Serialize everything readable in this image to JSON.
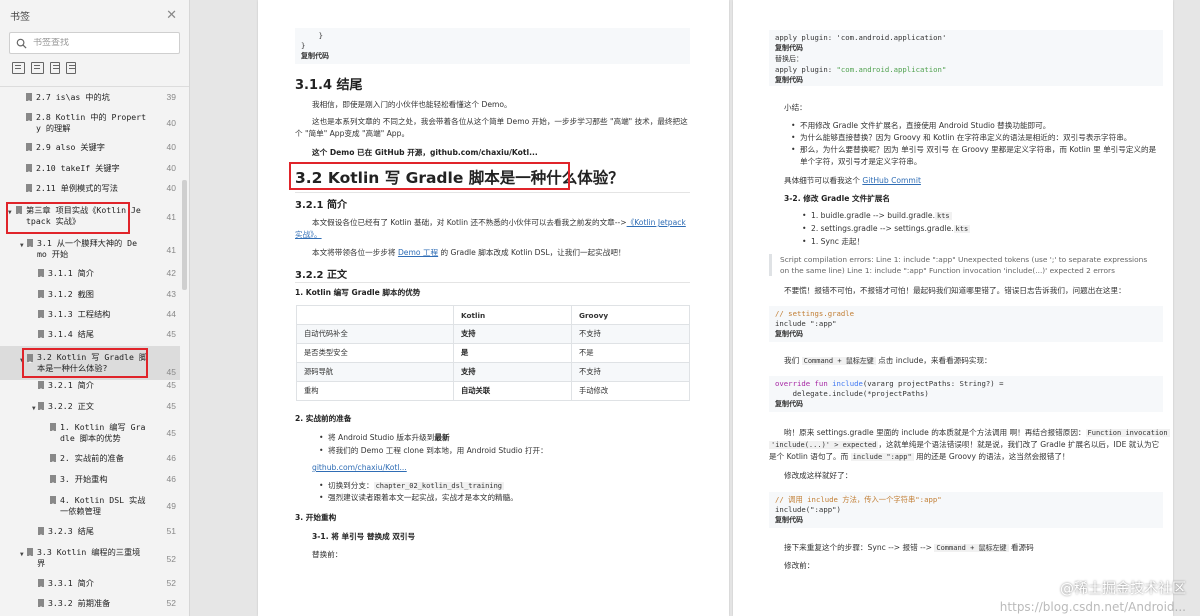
{
  "sidebar": {
    "title": "书签",
    "close_glyph": "✕",
    "search_placeholder": "书签查找",
    "items": [
      {
        "label": "2.7 is\\as 中的坑",
        "page": "39"
      },
      {
        "label": "2.8 Kotlin 中的 Propert\ny 的理解",
        "page": "40"
      },
      {
        "label": "2.9 also 关键字",
        "page": "40"
      },
      {
        "label": "2.10 takeIf 关键字",
        "page": "40"
      },
      {
        "label": "2.11 单例模式的写法",
        "page": "40"
      },
      {
        "label": "第三章 项目实战《Kotlin Je\ntpack 实战》",
        "page": "41"
      },
      {
        "label": "3.1 从一个膜拜大神的 De\nmo 开始",
        "page": "41"
      },
      {
        "label": "3.1.1 简介",
        "page": "42"
      },
      {
        "label": "3.1.2 截图",
        "page": "43"
      },
      {
        "label": "3.1.3 工程结构",
        "page": "44"
      },
      {
        "label": "3.1.4 结尾",
        "page": "45"
      },
      {
        "label": "3.2 Kotlin 写 Gradle 脚\n本是一种什么体验?",
        "page": "45"
      },
      {
        "label": "3.2.1 简介",
        "page": "45"
      },
      {
        "label": "3.2.2 正文",
        "page": "45"
      },
      {
        "label": "1. Kotlin 编写 Gra\ndle 脚本的优势",
        "page": "45"
      },
      {
        "label": "2. 实战前的准备",
        "page": "46"
      },
      {
        "label": "3. 开始重构",
        "page": "46"
      },
      {
        "label": "4. Kotlin DSL 实战\n一依赖管理",
        "page": "49"
      },
      {
        "label": "3.2.3 结尾",
        "page": "51"
      },
      {
        "label": "3.3 Kotlin 编程的三重境\n界",
        "page": "52"
      },
      {
        "label": "3.3.1 简介",
        "page": "52"
      },
      {
        "label": "3.3.2 前期准备",
        "page": "52"
      }
    ]
  },
  "page1": {
    "code_top": [
      "    }",
      "}"
    ],
    "copy": "复制代码",
    "h_3_1_4": "3.1.4 结尾",
    "p1": "我相信，即使是刚入门的小伙伴也能轻松看懂这个 Demo。",
    "p2a": "这也是本系列文章的 不同之处，我会带着各位从这个简单 Demo 开始，一步步学习那些 \"高端\" 技术，最终把这",
    "p2b": "个 \"简单\" App变成 \"高端\" App。",
    "p3": "这个 Demo 已在 GitHub 开源，github.com/chaxiu/Kotl...",
    "h_3_2": "3.2 Kotlin 写 Gradle 脚本是一种什么体验？",
    "h_3_2_1": "3.2.1 简介",
    "p4a": "本文假设各位已经有了 Kotlin 基础，对 Kotlin 还不熟悉的小伙伴可以去看我之前发的文章-->",
    "p4link1": "《Kotlin Jetpack",
    "p4link2": "实战》。",
    "p5a": "本文将带领各位一步步将 ",
    "p5link": "Demo 工程",
    "p5b": " 的 Gradle 脚本改成 Kotlin DSL，让我们一起实战吧！",
    "h_3_2_2": "3.2.2 正文",
    "h_adv": "1. Kotlin 编写 Gradle 脚本的优势",
    "table": {
      "headers": [
        "",
        "Kotlin",
        "Groovy"
      ],
      "rows": [
        [
          "自动代码补全",
          "支持",
          "不支持"
        ],
        [
          "是否类型安全",
          "是",
          "不是"
        ],
        [
          "源码导航",
          "支持",
          "不支持"
        ],
        [
          "重构",
          "自动关联",
          "手动修改"
        ]
      ]
    },
    "h_prep": "2. 实战前的准备",
    "b1a": "将 Android Studio 版本升级到",
    "b1b": "最新",
    "b2": "将我们的 Demo 工程 clone 到本地，用 Android Studio 打开：",
    "link_repo": "github.com/chaxiu/Kotl...",
    "b3a": "切换到分支：",
    "b3code": "chapter_02_kotlin_dsl_training",
    "b4": "强烈建议读者跟着本文一起实战，实战才是本文的精髓。",
    "h_refactor": "3. 开始重构",
    "h_3_1": "3-1. 将 单引号 替换成 双引号",
    "before": "替换前："
  },
  "page2": {
    "code1": [
      "apply plugin: 'com.android.application'"
    ],
    "copy": "复制代码",
    "after": "替换后：",
    "code2a": "apply plugin: ",
    "code2b": "\"com.android.application\"",
    "summary": "小结：",
    "s1": "不用修改 Gradle 文件扩展名，直接使用 Android Studio 替换功能即可。",
    "s2": "为什么能够直接替换？因为 Groovy 和 Kotlin 在字符串定义的语法是相近的：双引号表示字符串。",
    "s3a": "那么，为什么要替换呢？因为 单引号 双引号 在 Groovy 里都是定义字符串，而 Kotlin 里 单引号定义的是",
    "s3b": "单个字符，双引号才是定义字符串。",
    "detail_a": "具体细节可以看我这个 ",
    "detail_link": "GitHub Commit",
    "h_ext": "3-2. 修改 Gradle 文件扩展名",
    "n1a": "1. buidle.gradle --> build.gradle.",
    "n1b": "kts",
    "n2a": "2. settings.gradle --> settings.gradle.",
    "n2b": "kts",
    "n3": "1. Sync 走起！",
    "quote_a": "Script compilation errors: Line 1: include \":app\" Unexpected tokens (use ';' to separate expressions",
    "quote_b": "on the same line) Line 1: include \":app\" Function invocation 'include(...)' expected 2 errors",
    "panic": "不要慌！报错不可怕，不报错才可怕！最起码我们知道哪里错了。错误日志告诉我们，问题出在这里：",
    "code3_comment": "// settings.gradle",
    "code3_line": "include \":app\"",
    "note_a": "我们 ",
    "note_code": "Command + 鼠标左键",
    "note_b": " 点击 include，来看看源码实现：",
    "code4_kw": "override fun ",
    "code4_fn": "include",
    "code4_rest": "(vararg projectPaths: String?) =",
    "code4_line2": "    delegate.include(*projectPaths)",
    "exp_a": "哟！原来 settings.gradle 里面的 include 的本质就是个方法调用 啊！再结合报错原因：",
    "exp_code1": "Function invocation",
    "exp_code2": "'include(...)' > expected",
    "exp_b": "，这就单纯是个语法错误呗！就是说，我们改了 Gradle 扩展名以后，IDE 就认为它",
    "exp_c": "是个 Kotlin 语句了。而 ",
    "exp_code3": "include \":app\"",
    "exp_d": " 用的还是 Groovy 的语法，这当然会报错了！",
    "fix": "修改成这样就好了：",
    "code5_comment": "// 调用 include 方法，传入一个字符串\":app\"",
    "code5_line": "include(\":app\")",
    "next_a": "接下来重复这个的步骤：Sync --> 报错 --> ",
    "next_code": "Command + 鼠标左键",
    "next_b": " 看源码",
    "before": "修改前："
  },
  "watermark": "@稀土掘金技术社区",
  "watermark2": "https://blog.csdn.net/Android..."
}
